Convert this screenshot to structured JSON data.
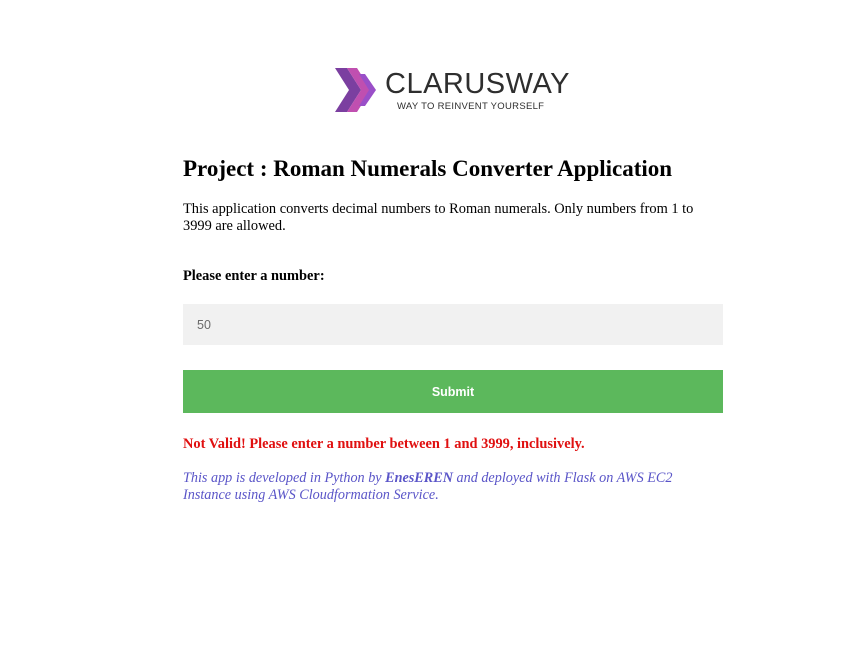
{
  "logo": {
    "name": "CLARUSWAY",
    "tagline": "WAY TO REINVENT YOURSELF",
    "colors": [
      "#7b3fa0",
      "#c04fb0",
      "#9a4fc8"
    ]
  },
  "page": {
    "title": "Project : Roman Numerals Converter Application",
    "description": "This application converts decimal numbers to Roman numerals. Only numbers from 1 to 3999 are allowed."
  },
  "form": {
    "label": "Please enter a number:",
    "input_value": "50",
    "submit_label": "Submit",
    "submit_color": "#5cb85c"
  },
  "result": {
    "error": "Not Valid! Please enter a number between 1 and 3999, inclusively.",
    "error_color": "#e01010"
  },
  "footer": {
    "prefix": "This app is developed in Python by ",
    "author": "EnesEREN",
    "suffix": " and deployed with Flask on AWS EC2 Instance using AWS Cloudformation Service.",
    "color": "#5a55c8"
  }
}
